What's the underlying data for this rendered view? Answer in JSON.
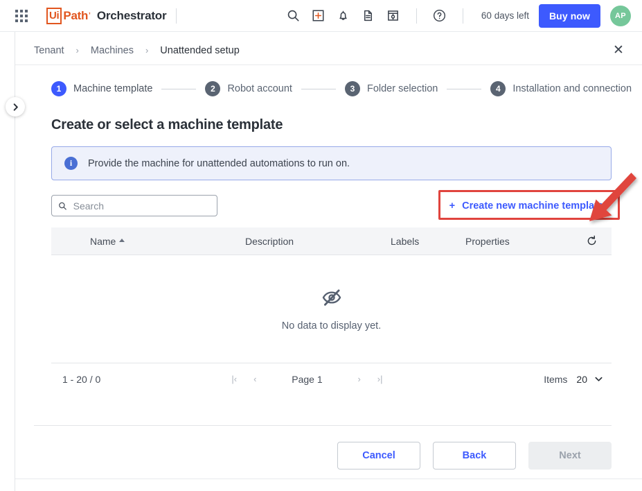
{
  "header": {
    "apps_icon": "apps-grid-icon",
    "logo_ui": "Ui",
    "logo_path": "Path",
    "logo_tick": "’",
    "product_name": "Orchestrator",
    "icons": [
      {
        "name": "search-icon",
        "title": "Search"
      },
      {
        "name": "add-box-icon",
        "title": "Add"
      },
      {
        "name": "bell-icon",
        "title": "Notifications"
      },
      {
        "name": "document-icon",
        "title": "Documents"
      },
      {
        "name": "window-settings-icon",
        "title": "Settings"
      },
      {
        "name": "help-circle-icon",
        "title": "Help"
      }
    ],
    "days_left": "60 days left",
    "buy_now": "Buy now",
    "avatar_initials": "AP"
  },
  "breadcrumb": {
    "items": [
      {
        "label": "Tenant"
      },
      {
        "label": "Machines"
      },
      {
        "label": "Unattended setup"
      }
    ],
    "separator": "›",
    "close": "✕"
  },
  "stepper": {
    "steps": [
      {
        "num": "1",
        "label": "Machine template",
        "active": true
      },
      {
        "num": "2",
        "label": "Robot account",
        "active": false
      },
      {
        "num": "3",
        "label": "Folder selection",
        "active": false
      },
      {
        "num": "4",
        "label": "Installation and connection",
        "active": false
      }
    ]
  },
  "main": {
    "page_title": "Create or select a machine template",
    "info_banner": {
      "icon_char": "i",
      "text": "Provide the machine for unattended automations to run on."
    },
    "search": {
      "placeholder": "Search",
      "value": ""
    },
    "create_button": {
      "plus": "+",
      "label": "Create new machine template"
    },
    "table": {
      "columns": [
        "Name",
        "Description",
        "Labels",
        "Properties"
      ],
      "sort_column": "Name",
      "sort_direction": "ascending",
      "rows": [],
      "empty_message": "No data to display yet.",
      "refresh_icon": "refresh-icon",
      "empty_icon": "eye-off-icon"
    },
    "pagination": {
      "range": "1 - 20 / 0",
      "first": "|‹",
      "prev": "‹",
      "page_label": "Page 1",
      "next": "›",
      "last": "›|",
      "items_label": "Items",
      "items_value": "20"
    }
  },
  "footer": {
    "cancel": "Cancel",
    "back": "Back",
    "next": "Next"
  },
  "rail": {
    "expand_icon": "chevron-right-icon"
  },
  "colors": {
    "brand_orange": "#e1561f",
    "accent_blue": "#3d5afe",
    "step_gray": "#5a6472",
    "annotation_red": "#e0443e",
    "avatar_green": "#75c79a",
    "info_bg": "#eef1fb",
    "info_border": "#97a9e8"
  }
}
